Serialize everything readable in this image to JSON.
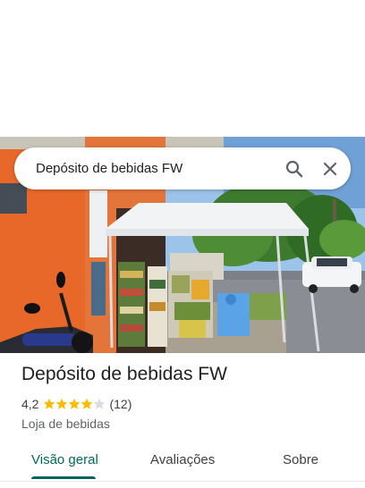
{
  "search": {
    "query": "Depósito de bebidas FW",
    "search_icon": "search-icon",
    "close_icon": "close-icon"
  },
  "place": {
    "photo": "storefront-photo",
    "name": "Depósito de bebidas FW",
    "rating": "4,2",
    "rating_value": 4.2,
    "stars_max": 5,
    "review_count": "(12)",
    "category": "Loja de bebidas"
  },
  "tabs": [
    {
      "label": "Visão geral",
      "selected": true
    },
    {
      "label": "Avaliações",
      "selected": false
    },
    {
      "label": "Sobre",
      "selected": false
    }
  ],
  "colors": {
    "accent": "#01665e",
    "star": "#fbbc04",
    "star_empty": "#dadce0"
  }
}
